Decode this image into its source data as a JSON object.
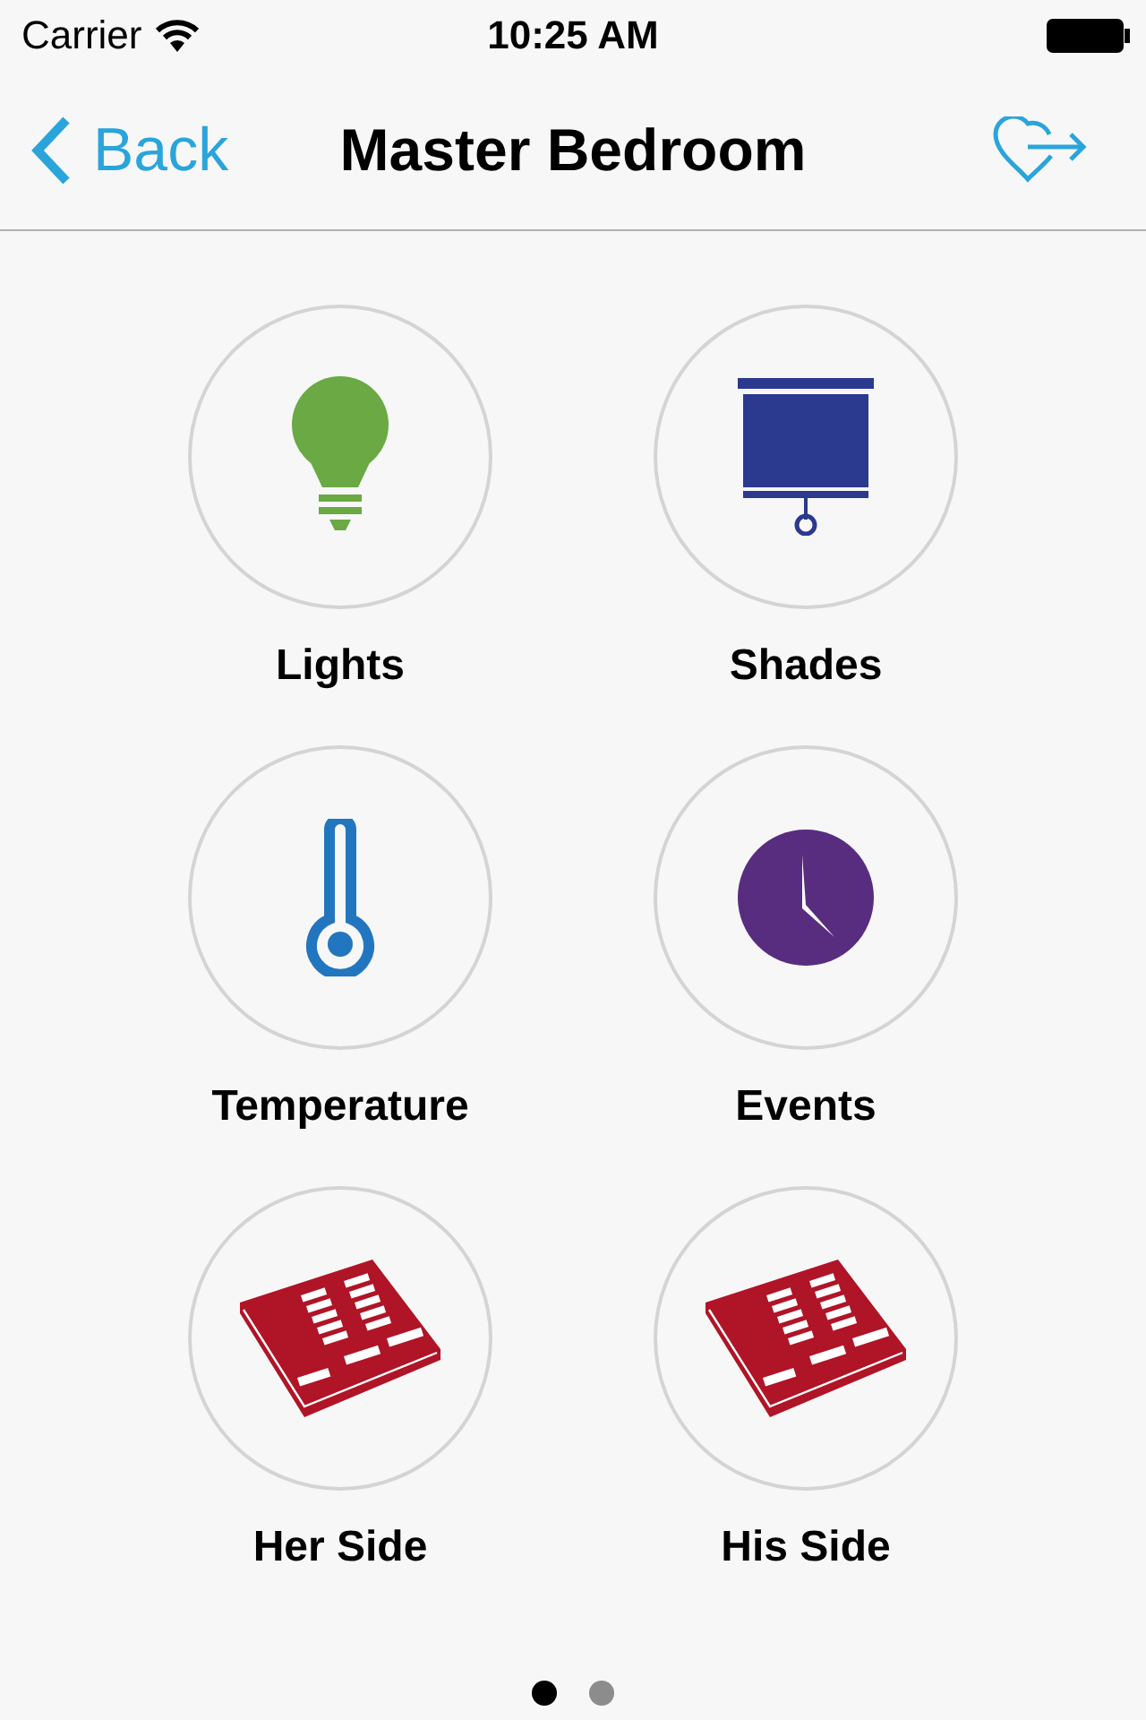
{
  "status_bar": {
    "carrier": "Carrier",
    "time": "10:25 AM"
  },
  "nav": {
    "back": "Back",
    "title": "Master Bedroom"
  },
  "tiles": [
    {
      "kind": "lights",
      "label": "Lights"
    },
    {
      "kind": "shades",
      "label": "Shades"
    },
    {
      "kind": "temperature",
      "label": "Temperature"
    },
    {
      "kind": "events",
      "label": "Events"
    },
    {
      "kind": "keypad",
      "label": "Her Side"
    },
    {
      "kind": "keypad",
      "label": "His Side"
    }
  ],
  "pages": [
    {
      "selected": true
    },
    {
      "selected": false
    }
  ]
}
